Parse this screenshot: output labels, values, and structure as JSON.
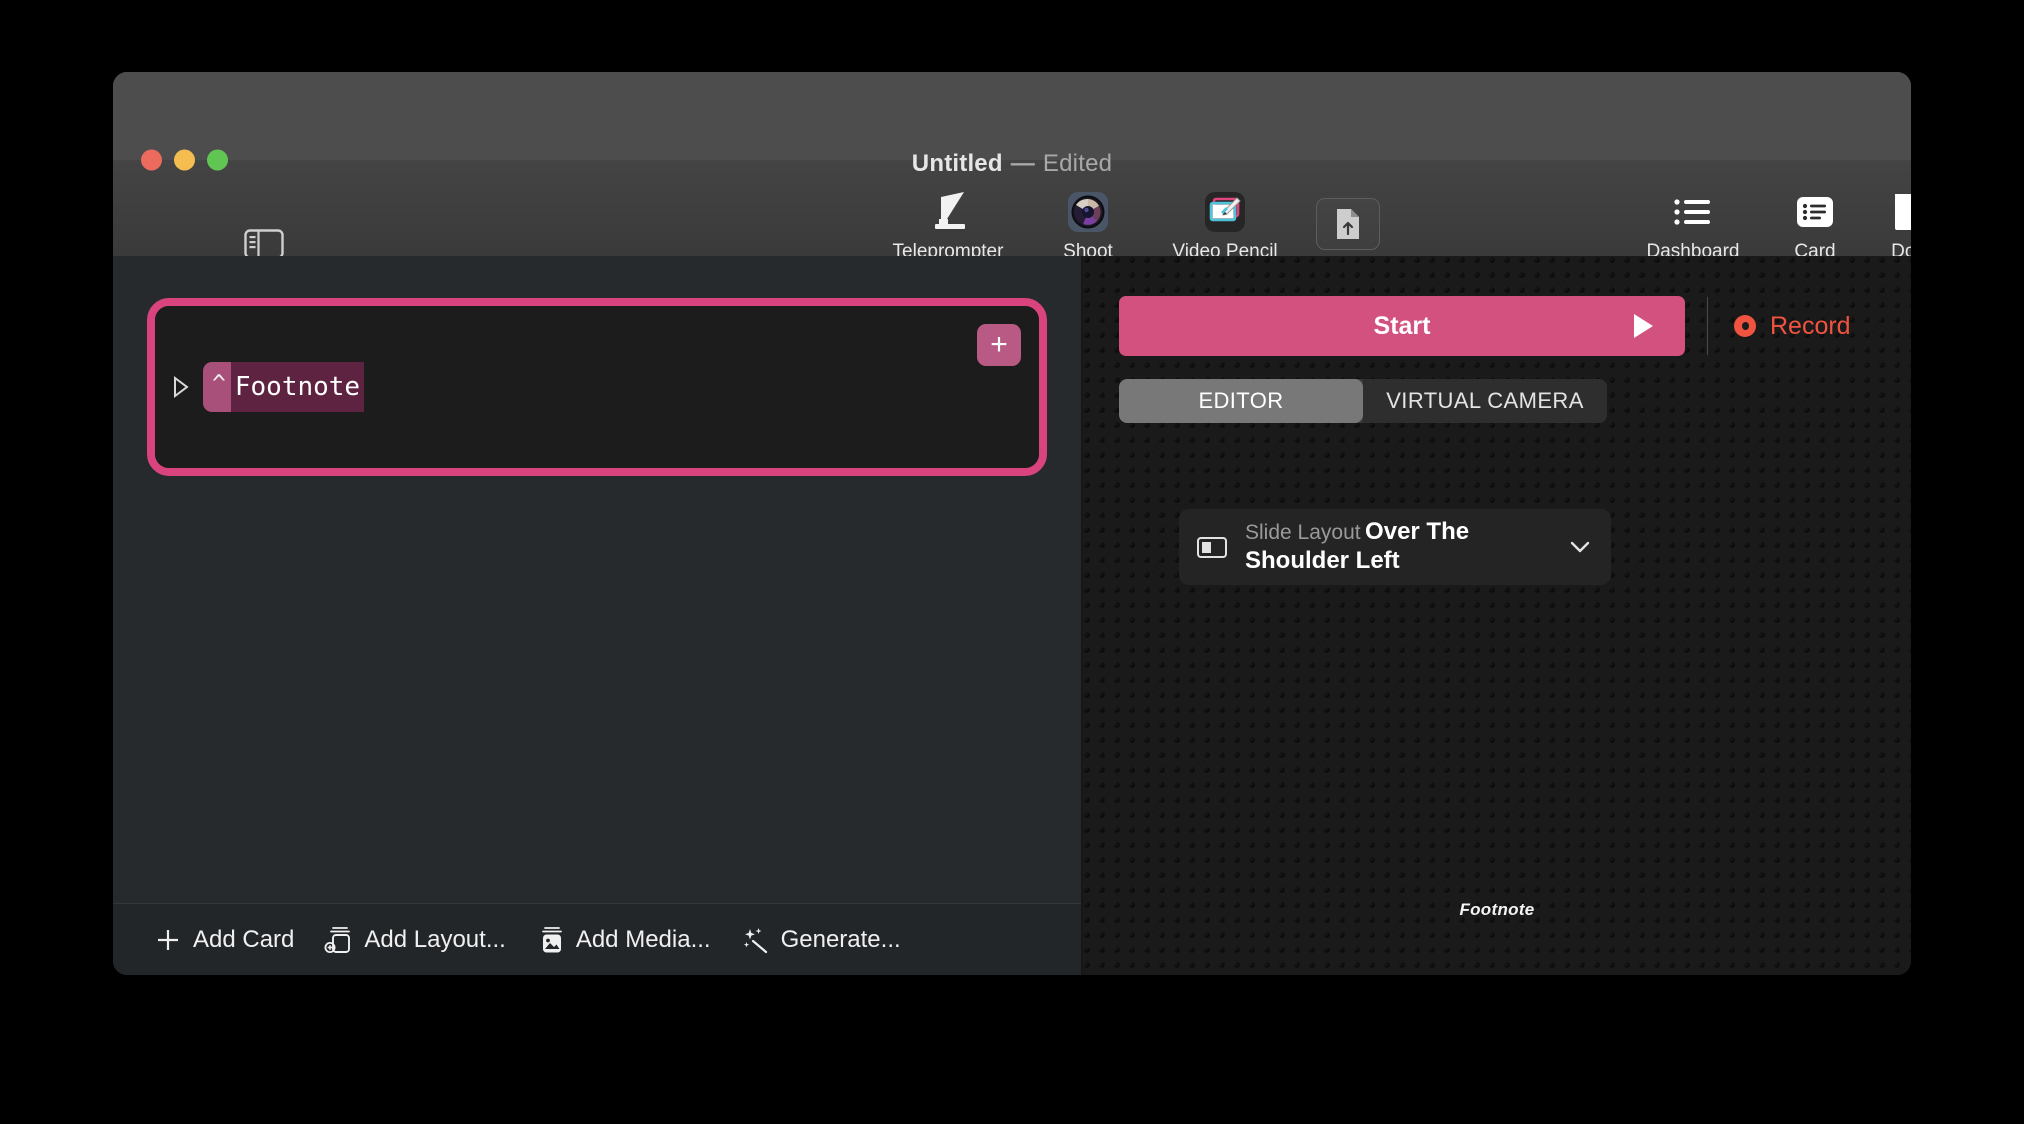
{
  "window": {
    "title": "Untitled",
    "dash": "—",
    "edited": "Edited",
    "traffic_lights": [
      "close",
      "minimize",
      "zoom"
    ]
  },
  "toolbar": {
    "sidebar_toggle_icon": "sidebar-toggle-icon",
    "items": [
      {
        "label": "Teleprompter",
        "icon": "teleprompter-icon"
      },
      {
        "label": "Shoot",
        "icon": "camera-lens-icon"
      },
      {
        "label": "Video Pencil",
        "icon": "video-pencil-icon"
      }
    ],
    "export_icon": "document-upload-icon",
    "right_items": [
      {
        "label": "Dashboard",
        "icon": "list-bullet-icon"
      },
      {
        "label": "Card",
        "icon": "card-list-icon"
      },
      {
        "label": "Doc",
        "icon": "document-icon"
      }
    ],
    "search_icon": "search-icon"
  },
  "card": {
    "disclosure_icon": "disclosure-triangle-icon",
    "token_caret": "^",
    "token_text": "Footnote",
    "add_label": "+",
    "selection_color": "#d9447e"
  },
  "bottom_bar": {
    "items": [
      {
        "label": "Add Card",
        "icon": "plus-icon"
      },
      {
        "label": "Add Layout...",
        "icon": "add-layout-icon"
      },
      {
        "label": "Add Media...",
        "icon": "add-media-icon"
      },
      {
        "label": "Generate...",
        "icon": "sparkle-wand-icon"
      }
    ]
  },
  "right_panel": {
    "start_label": "Start",
    "start_icon": "play-triangle-icon",
    "start_color": "#d2517e",
    "record_label": "Record",
    "record_icon": "record-dot-icon",
    "record_color": "#f05340",
    "segmented": [
      {
        "label": "EDITOR",
        "active": true
      },
      {
        "label": "VIRTUAL CAMERA",
        "active": false
      }
    ],
    "slide_layout": {
      "icon": "slide-layout-icon",
      "title": "Slide Layout",
      "value": "Over The Shoulder Left",
      "chevron_icon": "chevron-down-icon"
    },
    "preview_footnote": "Footnote"
  }
}
